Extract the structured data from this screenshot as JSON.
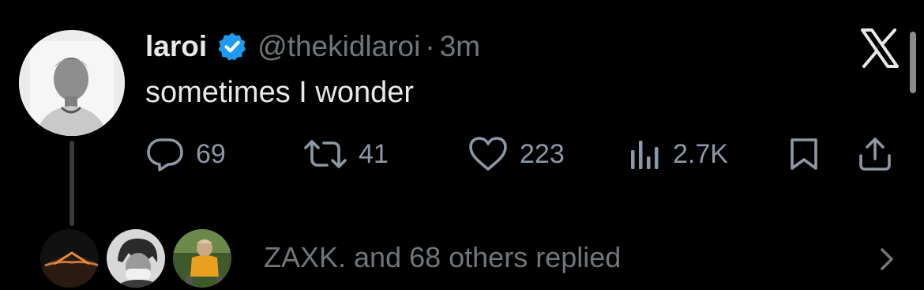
{
  "tweet": {
    "author_name": "laroi",
    "handle": "@thekidlaroi",
    "separator": "·",
    "time": "3m",
    "text": "sometimes I wonder",
    "verified_color": "#1d9bf0"
  },
  "actions": {
    "replies": "69",
    "retweets": "41",
    "likes": "223",
    "views": "2.7K"
  },
  "icons": {
    "reply": "reply-icon",
    "retweet": "retweet-icon",
    "like": "heart-icon",
    "views": "views-icon",
    "bookmark": "bookmark-icon",
    "share": "share-icon",
    "brand": "x-logo-icon",
    "more": "chevron-right-icon"
  },
  "replies_summary": {
    "text": "ZAXK. and 68 others replied"
  },
  "colors": {
    "background": "#000000",
    "text_primary": "#e7e9ea",
    "text_secondary": "#71767b",
    "accent": "#1d9bf0"
  }
}
